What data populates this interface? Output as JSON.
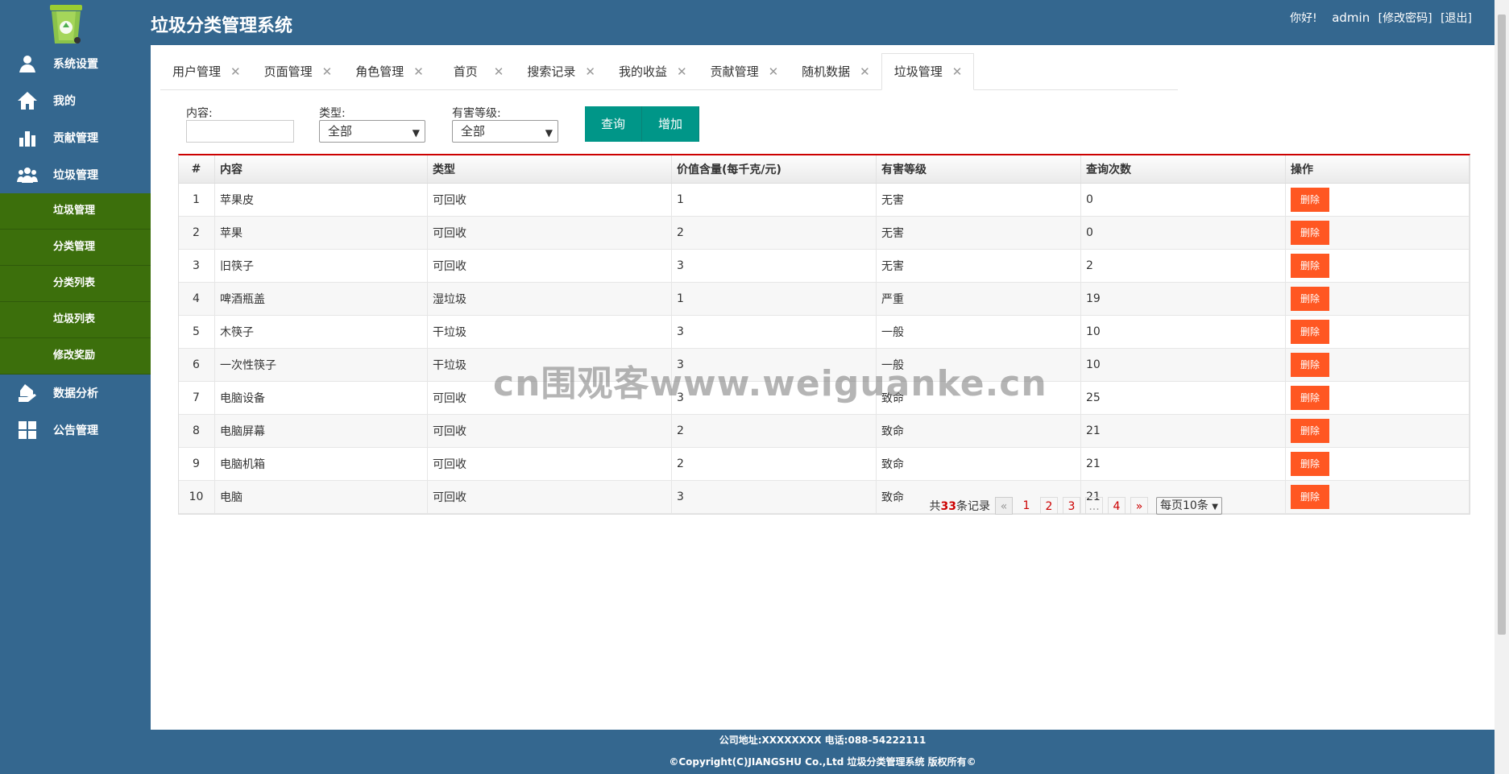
{
  "header": {
    "title": "垃圾分类管理系统",
    "greeting": "你好!",
    "username": "admin",
    "change_password": "[修改密码]",
    "logout": "[退出]"
  },
  "sidebar": {
    "items": [
      {
        "label": "系统设置",
        "icon": "user-icon"
      },
      {
        "label": "我的",
        "icon": "home-icon"
      },
      {
        "label": "贡献管理",
        "icon": "bar-chart-icon"
      },
      {
        "label": "垃圾管理",
        "icon": "group-icon"
      }
    ],
    "sub_items": [
      "垃圾管理",
      "分类管理",
      "分类列表",
      "垃圾列表",
      "修改奖励"
    ],
    "bottom_items": [
      {
        "label": "数据分析",
        "icon": "house-hand-icon"
      },
      {
        "label": "公告管理",
        "icon": "grid-icon"
      }
    ]
  },
  "tabs": [
    "用户管理",
    "页面管理",
    "角色管理",
    "首页",
    "搜索记录",
    "我的收益",
    "贡献管理",
    "随机数据",
    "垃圾管理"
  ],
  "active_tab": "垃圾管理",
  "filter": {
    "content_label": "内容:",
    "content_value": "",
    "type_label": "类型:",
    "type_value": "全部",
    "level_label": "有害等级:",
    "level_value": "全部",
    "query_button": "查询",
    "add_button": "增加"
  },
  "table": {
    "headers": [
      "#",
      "内容",
      "类型",
      "价值含量(每千克/元)",
      "有害等级",
      "查询次数",
      "操作"
    ],
    "delete_label": "删除",
    "rows": [
      [
        "1",
        "苹果皮",
        "可回收",
        "1",
        "无害",
        "0"
      ],
      [
        "2",
        "苹果",
        "可回收",
        "2",
        "无害",
        "0"
      ],
      [
        "3",
        "旧筷子",
        "可回收",
        "3",
        "无害",
        "2"
      ],
      [
        "4",
        "啤酒瓶盖",
        "湿垃圾",
        "1",
        "严重",
        "19"
      ],
      [
        "5",
        "木筷子",
        "干垃圾",
        "3",
        "一般",
        "10"
      ],
      [
        "6",
        "一次性筷子",
        "干垃圾",
        "3",
        "一般",
        "10"
      ],
      [
        "7",
        "电脑设备",
        "可回收",
        "3",
        "致命",
        "25"
      ],
      [
        "8",
        "电脑屏幕",
        "可回收",
        "2",
        "致命",
        "21"
      ],
      [
        "9",
        "电脑机箱",
        "可回收",
        "2",
        "致命",
        "21"
      ],
      [
        "10",
        "电脑",
        "可回收",
        "3",
        "致命",
        "21"
      ]
    ]
  },
  "pager": {
    "total_prefix": "共",
    "total": "33",
    "total_suffix": "条记录",
    "prev": "«",
    "pages": [
      "1",
      "2",
      "3",
      "...",
      "4"
    ],
    "next": "»",
    "per_page": "每页10条"
  },
  "footer": {
    "line1": "公司地址:XXXXXXXX 电话:088-54222111",
    "line2": "©Copyright(C)JIANGSHU Co.,Ltd 垃圾分类管理系统 版权所有©"
  },
  "watermark": "cn围观客www.weiguanke.cn",
  "colors": {
    "header_bg": "#34678f",
    "submenu_bg": "#3c6f0c",
    "primary_button": "#009688",
    "delete_button": "#ff5722",
    "accent_red": "#cc0000"
  }
}
